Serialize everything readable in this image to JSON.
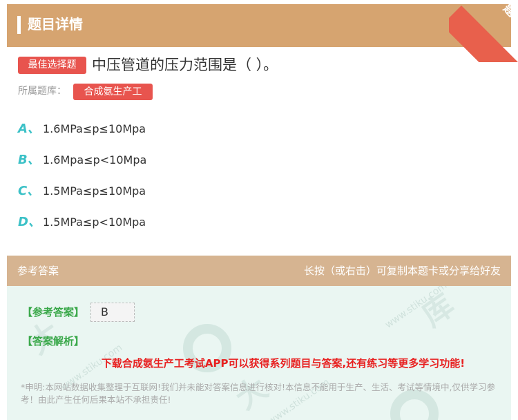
{
  "header": {
    "title": "题目详情"
  },
  "ribbon": {
    "text": "题卡"
  },
  "question": {
    "type_badge": "最佳选择题",
    "text": "中压管道的压力范围是（ ）。",
    "bank_label": "所属题库：",
    "bank_name": "合成氨生产工"
  },
  "options": [
    {
      "letter": "A、",
      "text": "1.6MPa≤p≤10Mpa"
    },
    {
      "letter": "B、",
      "text": "1.6Mpa≤p<10Mpa"
    },
    {
      "letter": "C、",
      "text": "1.5MPa≤p≤10Mpa"
    },
    {
      "letter": "D、",
      "text": "1.5MPa≤p<10Mpa"
    }
  ],
  "answer_section": {
    "title": "参考答案",
    "share_hint": "长按（或右击）可复制本题卡或分享给好友",
    "answer_label": "【参考答案】",
    "answer_value": "B",
    "analysis_label": "【答案解析】",
    "promo": "下载合成氨生产工考试APP可以获得系列题目与答案,还有练习等更多学习功能!",
    "disclaimer": "*申明:本网站数据收集整理于互联网!我们并未能对答案信息进行核对!本信息不能用于生产、生活、考试等情境中,仅供学习参考！由此产生任何后果本站不承担责任!",
    "watermark_text": "www.stiku.com"
  },
  "colors": {
    "header_bg": "#d6a470",
    "badge_red": "#e8544e",
    "option_letter": "#3cc1c7",
    "answer_green": "#3aa84a",
    "promo_red": "#e82020"
  }
}
